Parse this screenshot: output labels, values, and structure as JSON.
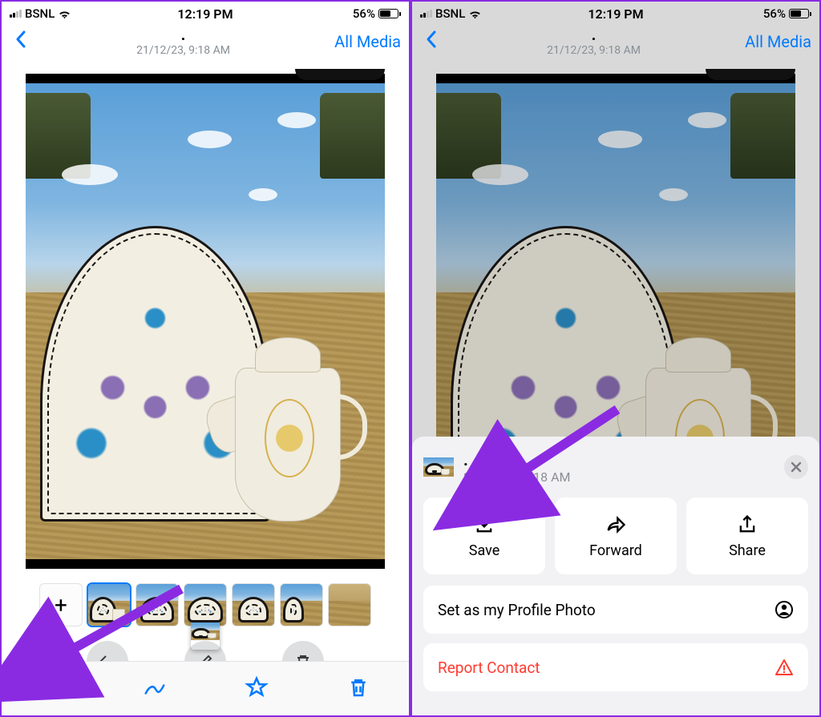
{
  "status": {
    "carrier": "BSNL",
    "time": "12:19 PM",
    "battery_pct": "56%"
  },
  "nav": {
    "title_dot": ".",
    "meta": "21/12/23, 9:18 AM",
    "all_media": "All Media"
  },
  "sheet": {
    "title_dot": ".",
    "meta": "21/12/23, 9:18 AM",
    "actions": {
      "save": "Save",
      "forward": "Forward",
      "share": "Share"
    },
    "set_profile": "Set as my Profile Photo",
    "report": "Report Contact"
  }
}
